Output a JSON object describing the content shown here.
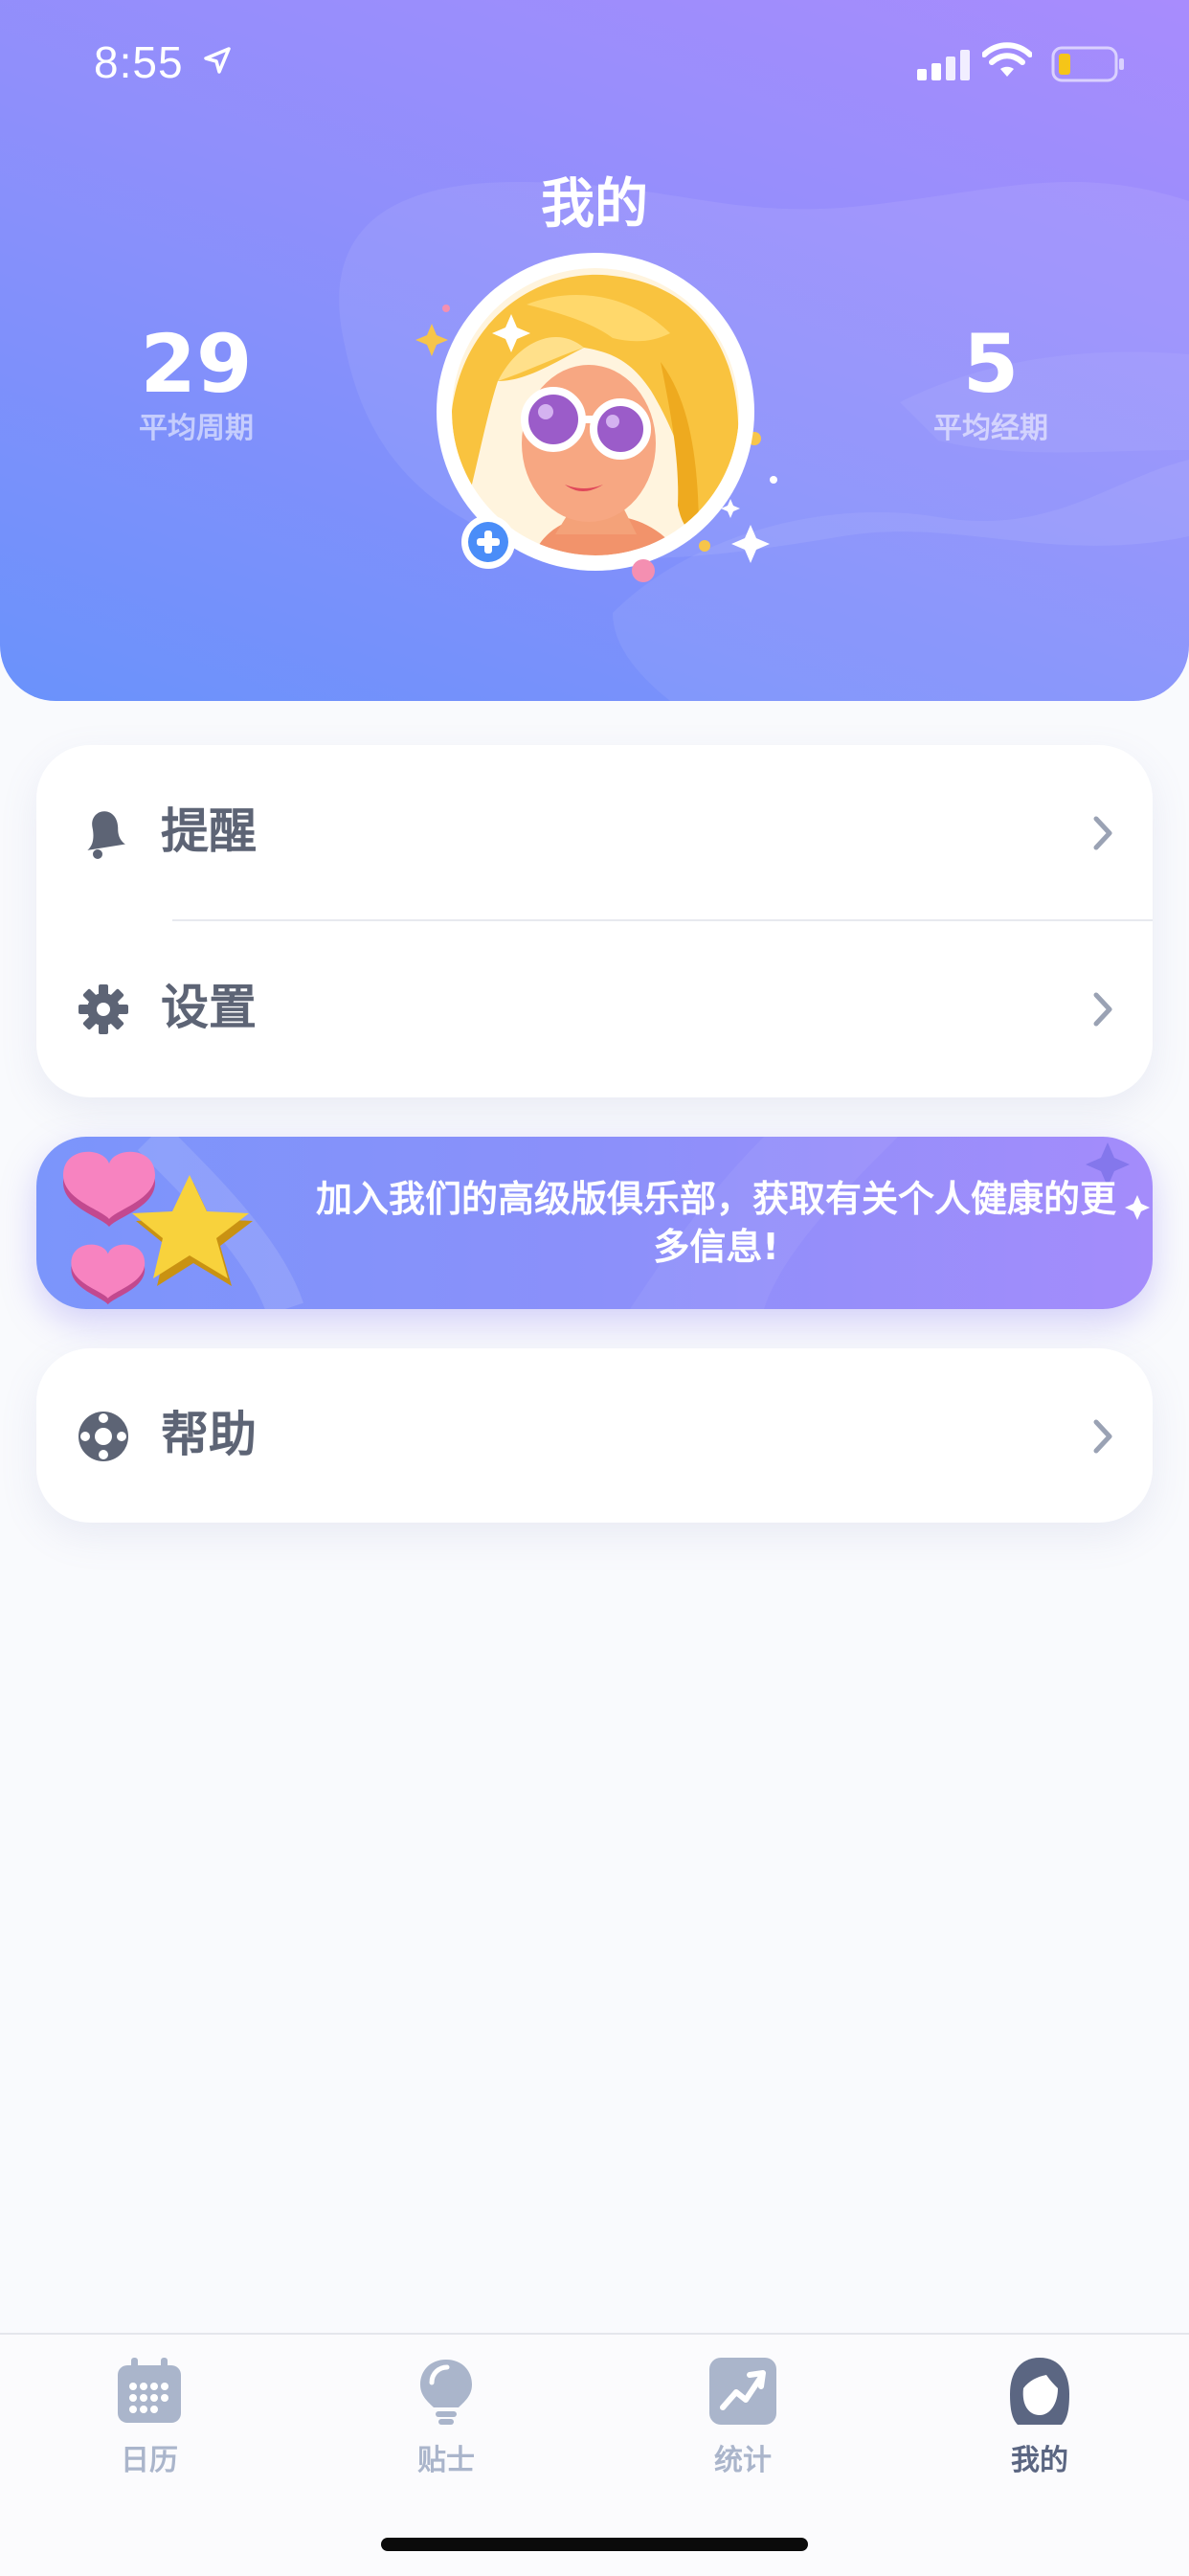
{
  "status_bar": {
    "time": "8:55"
  },
  "header": {
    "title": "我的",
    "avg_cycle": {
      "value": "29",
      "label": "平均周期"
    },
    "avg_period": {
      "value": "5",
      "label": "平均经期"
    }
  },
  "menu": {
    "reminders": "提醒",
    "settings": "设置",
    "help": "帮助"
  },
  "promo": {
    "text": "加入我们的高级版俱乐部，获取有关个人健康的更多信息!"
  },
  "tabs": [
    {
      "label": "日历",
      "icon": "calendar-icon",
      "active": false
    },
    {
      "label": "贴士",
      "icon": "lightbulb-icon",
      "active": false
    },
    {
      "label": "统计",
      "icon": "chart-trend-icon",
      "active": false
    },
    {
      "label": "我的",
      "icon": "profile-icon",
      "active": true
    }
  ],
  "colors": {
    "header_start": "#6a92fb",
    "header_end": "#a88cfd",
    "text_muted": "#5d6475",
    "tab_inactive": "#aab5cb",
    "tab_active": "#5b6682",
    "add_badge": "#4a8df8"
  }
}
